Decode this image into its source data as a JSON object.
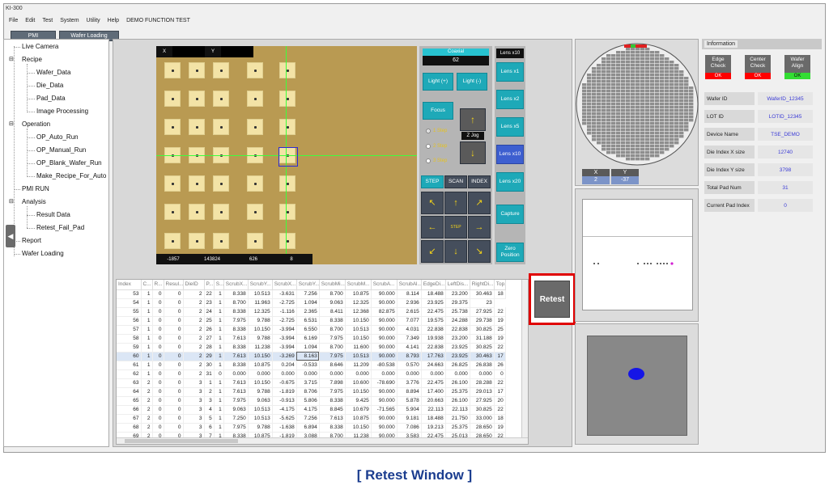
{
  "app": {
    "title": "KI-300"
  },
  "menu": [
    "File",
    "Edit",
    "Test",
    "System",
    "Utility",
    "Help",
    "DEMO FUNCTION TEST"
  ],
  "toolbar": {
    "pmi": "PMI",
    "wafer_loading": "Wafer Loading"
  },
  "tree": {
    "live_camera": "Live Camera",
    "recipe": "Recipe",
    "wafer_data": "Wafer_Data",
    "die_data": "Die_Data",
    "pad_data": "Pad_Data",
    "image_processing": "Image Processing",
    "operation": "Operation",
    "op_auto_run": "OP_Auto_Run",
    "op_manual_run": "OP_Manual_Run",
    "op_blank_wafer_run": "OP_Blank_Wafer_Run",
    "make_recipe_for_auto": "Make_Recipe_For_Auto",
    "pmi_run": "PMI RUN",
    "analysis": "Analysis",
    "result_data": "Result Data",
    "retest_fail_pad": "Retest_Fail_Pad",
    "report": "Report",
    "wafer_loading": "Wafer Loading"
  },
  "camera": {
    "x_label": "X",
    "y_label": "Y",
    "readouts": [
      "-1857",
      "143824",
      "626",
      "8"
    ]
  },
  "controls": {
    "coaxial_label": "Coaxial",
    "coaxial_value": "62",
    "light_plus": "Light (+)",
    "light_minus": "Light (-)",
    "focus": "Focus",
    "step1": "1 Step",
    "step2": "2 Step",
    "step3": "3 Step",
    "zjog": "Z Jog",
    "tab_step": "STEP",
    "tab_scan": "SCAN",
    "tab_index": "INDEX",
    "center_label": "STEP"
  },
  "lens": {
    "current": "Lens x10",
    "x1": "Lens x1",
    "x2": "Lens x2",
    "x5": "Lens x5",
    "x10": "Lens x10",
    "x20": "Lens x20",
    "capture": "Capture",
    "zero_position": "Zero Position"
  },
  "table": {
    "headers": [
      "Index",
      "C...",
      "R...",
      "Resul...",
      "DieID",
      "P...",
      "S...",
      "ScrubX...",
      "ScrubY...",
      "ScrubX...",
      "ScrubY...",
      "ScrubMi...",
      "ScrubM...",
      "ScrubA...",
      "ScrubAl...",
      "EdgeDi...",
      "LeftDis...",
      "RightDi...",
      "Top..."
    ],
    "rows": [
      [
        "53",
        "1",
        "0",
        "0",
        "2",
        "22",
        "1",
        "8.338",
        "10.513",
        "-3.631",
        "7.256",
        "8.700",
        "10.875",
        "90.000",
        "8.114",
        "18.488",
        "23.200",
        "30.463",
        "18"
      ],
      [
        "54",
        "1",
        "0",
        "0",
        "2",
        "23",
        "1",
        "8.700",
        "11.963",
        "-2.725",
        "1.094",
        "9.063",
        "12.325",
        "90.000",
        "2.936",
        "23.925",
        "29.375",
        "23"
      ],
      [
        "55",
        "1",
        "0",
        "0",
        "2",
        "24",
        "1",
        "8.338",
        "12.325",
        "-1.116",
        "2.365",
        "8.411",
        "12.368",
        "82.875",
        "2.615",
        "22.475",
        "25.738",
        "27.925",
        "22"
      ],
      [
        "56",
        "1",
        "0",
        "0",
        "2",
        "25",
        "1",
        "7.975",
        "9.788",
        "-2.725",
        "6.531",
        "8.338",
        "10.150",
        "90.000",
        "7.077",
        "19.575",
        "24.288",
        "29.738",
        "19"
      ],
      [
        "57",
        "1",
        "0",
        "0",
        "2",
        "26",
        "1",
        "8.338",
        "10.150",
        "-3.994",
        "6.550",
        "8.700",
        "10.513",
        "90.000",
        "4.031",
        "22.838",
        "22.838",
        "30.825",
        "25"
      ],
      [
        "58",
        "1",
        "0",
        "0",
        "2",
        "27",
        "1",
        "7.613",
        "9.788",
        "-3.994",
        "6.169",
        "7.975",
        "10.150",
        "90.000",
        "7.349",
        "19.938",
        "23.200",
        "31.188",
        "19"
      ],
      [
        "59",
        "1",
        "0",
        "0",
        "2",
        "28",
        "1",
        "8.338",
        "11.238",
        "-3.994",
        "1.094",
        "8.700",
        "11.600",
        "90.000",
        "4.141",
        "22.838",
        "23.925",
        "30.825",
        "22"
      ],
      [
        "60",
        "1",
        "0",
        "0",
        "2",
        "29",
        "1",
        "7.613",
        "10.150",
        "-3.269",
        "8.163",
        "7.975",
        "10.513",
        "90.000",
        "8.793",
        "17.763",
        "23.925",
        "30.463",
        "17"
      ],
      [
        "61",
        "1",
        "0",
        "0",
        "2",
        "30",
        "1",
        "8.338",
        "10.875",
        "0.204",
        "-0.533",
        "8.646",
        "11.209",
        "-80.538",
        "0.570",
        "24.663",
        "26.825",
        "26.838",
        "26"
      ],
      [
        "62",
        "1",
        "0",
        "0",
        "2",
        "31",
        "0",
        "0.000",
        "0.000",
        "0.000",
        "0.000",
        "0.000",
        "0.000",
        "0.000",
        "0.000",
        "0.000",
        "0.000",
        "0.000",
        "0"
      ],
      [
        "63",
        "2",
        "0",
        "0",
        "3",
        "1",
        "1",
        "7.613",
        "10.150",
        "-0.675",
        "3.715",
        "7.898",
        "10.600",
        "-78.690",
        "3.776",
        "22.475",
        "26.100",
        "28.288",
        "22"
      ],
      [
        "64",
        "2",
        "0",
        "0",
        "3",
        "2",
        "1",
        "7.613",
        "9.788",
        "-1.819",
        "8.706",
        "7.975",
        "10.150",
        "90.000",
        "8.894",
        "17.400",
        "25.375",
        "29.013",
        "17"
      ],
      [
        "65",
        "2",
        "0",
        "0",
        "3",
        "3",
        "1",
        "7.975",
        "9.063",
        "-0.913",
        "5.806",
        "8.338",
        "9.425",
        "90.000",
        "5.878",
        "20.663",
        "26.100",
        "27.925",
        "20"
      ],
      [
        "66",
        "2",
        "0",
        "0",
        "3",
        "4",
        "1",
        "9.063",
        "10.513",
        "-4.175",
        "4.175",
        "8.845",
        "10.679",
        "-71.565",
        "5.904",
        "22.113",
        "22.113",
        "30.825",
        "22"
      ],
      [
        "67",
        "2",
        "0",
        "0",
        "3",
        "5",
        "1",
        "7.250",
        "10.513",
        "-5.625",
        "7.256",
        "7.613",
        "10.875",
        "90.000",
        "9.181",
        "18.488",
        "21.750",
        "33.000",
        "18"
      ],
      [
        "68",
        "2",
        "0",
        "0",
        "3",
        "6",
        "1",
        "7.975",
        "9.788",
        "-1.638",
        "6.894",
        "8.338",
        "10.150",
        "90.000",
        "7.086",
        "19.213",
        "25.375",
        "28.650",
        "19"
      ],
      [
        "69",
        "2",
        "0",
        "0",
        "3",
        "7",
        "1",
        "8.338",
        "10.875",
        "-1.819",
        "3.088",
        "8.700",
        "11.238",
        "90.000",
        "3.583",
        "22.475",
        "25.013",
        "28.650",
        "22"
      ]
    ]
  },
  "retest_button": "Retest",
  "wafer_coords": {
    "x_label": "X",
    "y_label": "Y",
    "x_value": "2",
    "y_value": "-37"
  },
  "information": {
    "title": "Information",
    "edge_check": "Edge Check",
    "center_check": "Center Check",
    "wafer_align": "Wafer Align",
    "ok": "OK",
    "rows": [
      {
        "label": "Wafer ID",
        "value": "WaferID_12345"
      },
      {
        "label": "LOT ID",
        "value": "LOTID_12345"
      },
      {
        "label": "Device Name",
        "value": "TSE_DEMO"
      },
      {
        "label": "Die Index X size",
        "value": "12740"
      },
      {
        "label": "Die Index Y size",
        "value": "3798"
      },
      {
        "label": "Total Pad Num",
        "value": "31"
      },
      {
        "label": "Current Pad Index",
        "value": "0"
      }
    ]
  },
  "caption": "[ Retest Window ]",
  "colors": {
    "teal": "#1ea9b8",
    "fail_red": "#ff0000",
    "pass_green": "#33dd33",
    "highlight": "#e00000",
    "marker_blue": "#1515e6"
  }
}
